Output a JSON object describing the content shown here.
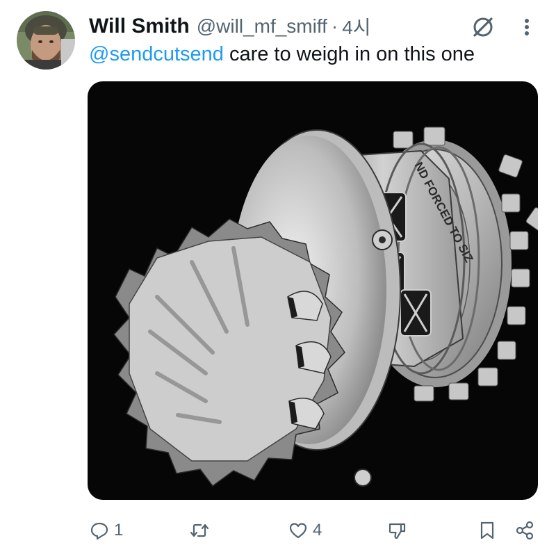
{
  "tweet": {
    "author_name": "Will Smith",
    "author_handle": "@will_mf_smiff",
    "separator": "·",
    "time": "4시",
    "mention": "@sendcutsend",
    "text": " care to weigh in on this one",
    "media": {
      "description_icon": "gear-assembly-render",
      "engraving_text": "ND FORCED TO SIZ"
    },
    "actions": {
      "reply_count": "1",
      "retweet_count": "",
      "like_count": "4"
    }
  },
  "colors": {
    "accent": "#1d9bf0",
    "secondary_text": "#536471",
    "media_background": "#060606"
  },
  "icons": [
    "grok-icon",
    "more-icon",
    "reply-icon",
    "retweet-icon",
    "like-icon",
    "dislike-icon",
    "bookmark-icon",
    "share-icon"
  ]
}
